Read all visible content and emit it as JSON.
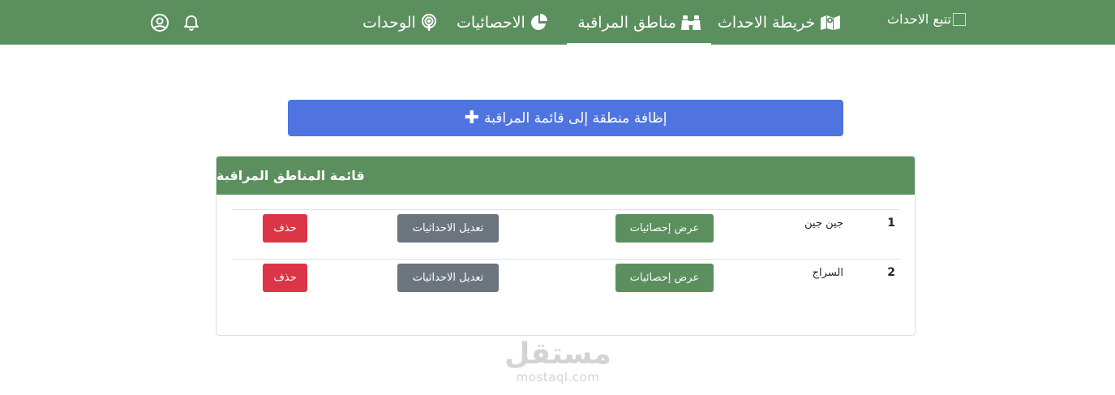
{
  "nav": {
    "brand_label": "تتبع الاحداث",
    "items": [
      {
        "label": "خريطة الاحداث",
        "icon": "map-icon"
      },
      {
        "label": "مناطق المراقبة",
        "icon": "binoculars-icon",
        "active": true
      },
      {
        "label": "الاحصائيات",
        "icon": "pie-chart-icon"
      },
      {
        "label": "الوحدات",
        "icon": "podcast-icon"
      }
    ],
    "right_icons": [
      "bell-icon",
      "user-circle-icon"
    ]
  },
  "add_button": {
    "label": "إظافة منطقة إلى قائمة المراقبة",
    "icon": "plus-icon"
  },
  "card": {
    "title": "قائمة المناطق المراقبة",
    "rows": [
      {
        "num": "1",
        "name": "جين جين",
        "stats_label": "عرض إحصائيات",
        "edit_label": "تعديل الاحداثيات",
        "delete_label": "حذف"
      },
      {
        "num": "2",
        "name": "السراج",
        "stats_label": "عرض إحصائيات",
        "edit_label": "تعديل الاحداثيات",
        "delete_label": "حذف"
      }
    ]
  },
  "watermark": {
    "arabic": "مستقل",
    "latin": "mostaql.com"
  },
  "colors": {
    "nav_bg": "#5b8f5e",
    "primary": "#4f74df",
    "success": "#5b8f5e",
    "secondary": "#6c757d",
    "danger": "#dc3545"
  }
}
